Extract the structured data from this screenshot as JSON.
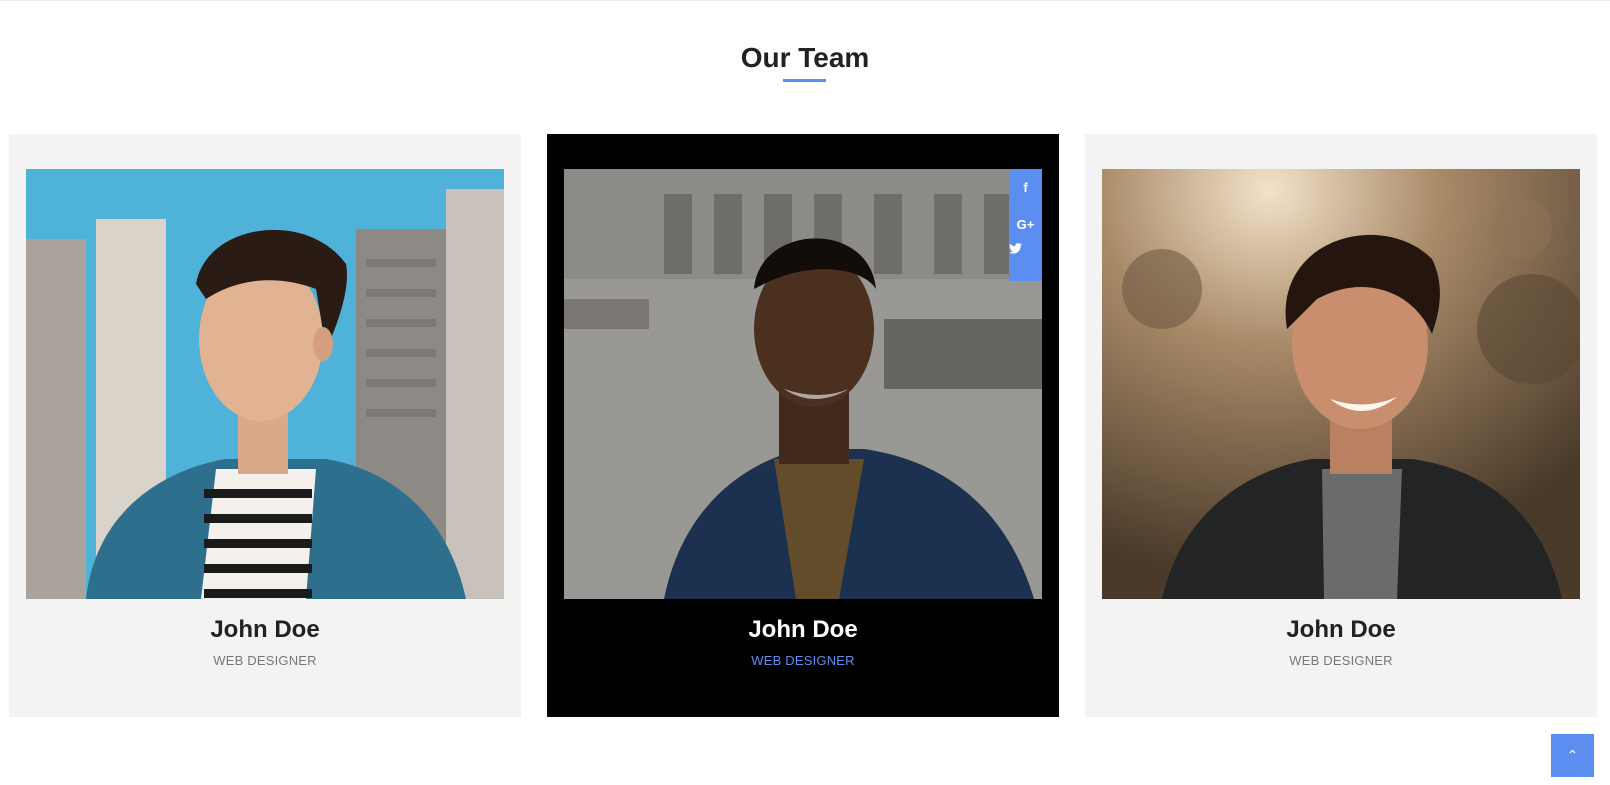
{
  "section": {
    "title": "Our Team",
    "accent_color": "#5b8ef0"
  },
  "members": [
    {
      "name": "John Doe",
      "role": "WEB DESIGNER",
      "photo": "man-looking-sideways-photo",
      "active": false
    },
    {
      "name": "John Doe",
      "role": "WEB DESIGNER",
      "photo": "smiling-man-in-suit-photo",
      "active": true
    },
    {
      "name": "John Doe",
      "role": "WEB DESIGNER",
      "photo": "smiling-young-man-photo",
      "active": false
    }
  ],
  "social": {
    "facebook": "f",
    "google_plus": "G+",
    "twitter": "twitter-icon"
  },
  "scroll_top": {
    "icon": "chevron-up-icon",
    "glyph": "⌃"
  }
}
